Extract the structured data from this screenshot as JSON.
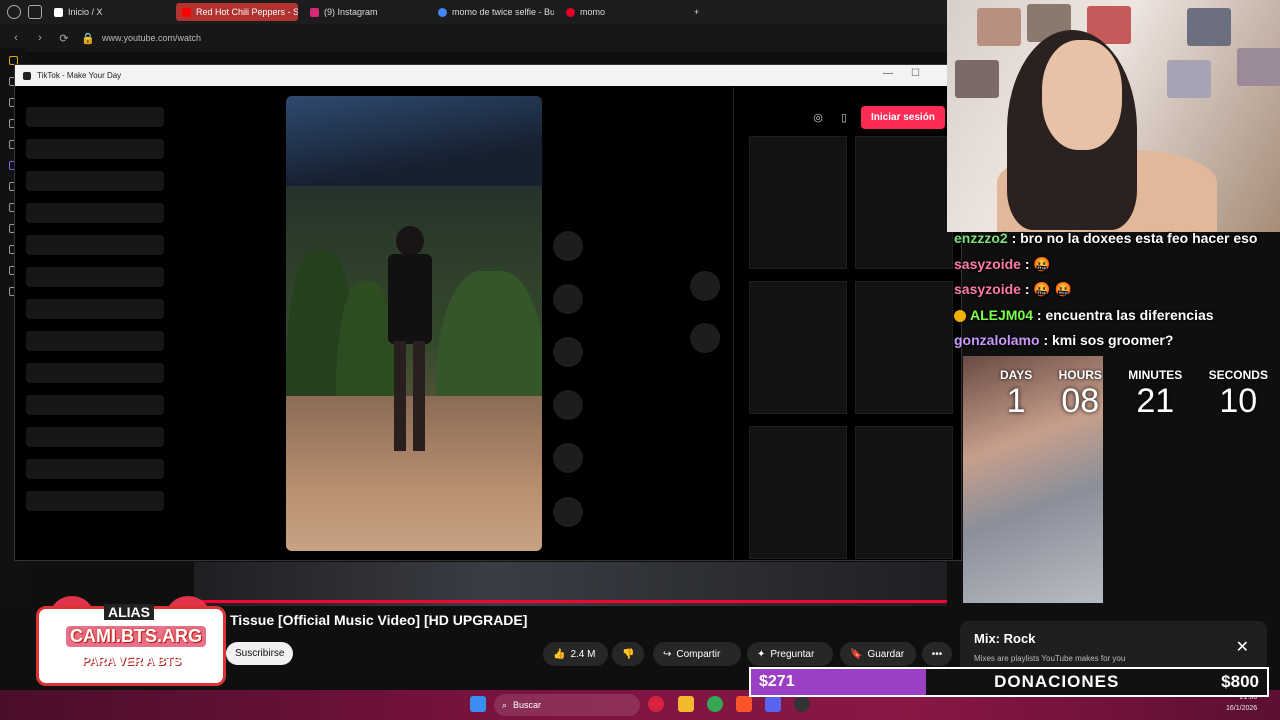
{
  "browser": {
    "tabs": [
      {
        "label": "Inicio / X",
        "icon": "x-icon",
        "color": "#ffffff"
      },
      {
        "label": "Red Hot Chili Peppers - S",
        "icon": "youtube-icon",
        "color": "#ff0000",
        "active": true
      },
      {
        "label": "(9) Instagram",
        "icon": "instagram-icon",
        "color": "#d62976"
      },
      {
        "label": "momo de twice selfie - Bu",
        "icon": "google-icon",
        "color": "#4285f4"
      },
      {
        "label": "momo",
        "icon": "pinterest-icon",
        "color": "#e60023"
      }
    ],
    "new_tab": "+",
    "url": "www.youtube.com/watch"
  },
  "tiktok_window": {
    "title": "TikTok - Make Your Day",
    "login_label": "Iniciar sesión"
  },
  "youtube": {
    "video_title": "Tissue [Official Music Video] [HD UPGRADE]",
    "subscribe_label": "Suscribirse",
    "likes": "2.4 M",
    "share_label": "Compartir",
    "ask_label": "Preguntar",
    "save_label": "Guardar",
    "more_label": "•••",
    "mix": {
      "title": "Mix: Rock",
      "subtitle": "Mixes are playlists YouTube makes for you"
    }
  },
  "stream": {
    "chat": [
      {
        "user": "enzzzo2",
        "text": " : bro no la doxees esta feo hacer eso",
        "color": "#7ee07a"
      },
      {
        "user": "sasyzoide",
        "text": " : 🤬",
        "color": "#ff7aa8"
      },
      {
        "user": "sasyzoide",
        "text": " : 🤬 🤬",
        "color": "#ff7aa8"
      },
      {
        "user": "ALEJM04",
        "text": " : encuentra las diferencias",
        "color": "#7eff4a"
      },
      {
        "user": "gonzalolamo",
        "text": " : kmi sos groomer?",
        "color": "#c99bff"
      }
    ],
    "countdown": [
      {
        "label": "DAYS",
        "value": "1"
      },
      {
        "label": "HOURS",
        "value": "08"
      },
      {
        "label": "MINUTES",
        "value": "21"
      },
      {
        "label": "SECONDS",
        "value": "10"
      }
    ],
    "donation": {
      "current": "$271",
      "label": "DONACIONES",
      "goal": "$800",
      "progress": 0.34
    },
    "alias": {
      "line1": "ALIAS",
      "line2": "CAMI.BTS.ARG",
      "line3": "PARA VER A BTS"
    }
  },
  "taskbar": {
    "search_label": "Buscar",
    "time": "21:06",
    "date": "16/1/2026"
  }
}
